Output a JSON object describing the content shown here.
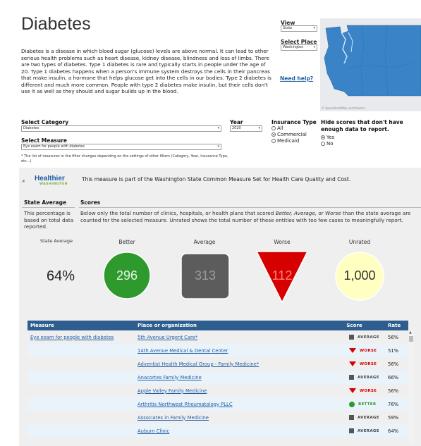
{
  "page": {
    "title": "Diabetes",
    "description": "Diabetes is a disease in which blood sugar (glucose) levels are above normal. It can lead to other serious health problems such as heart disease, kidney disease, blindness and loss of limbs. There are two types of diabetes. Type 1 diabetes is rare and typically starts in people under the age of 20. Type 1 diabetes happens when a person's immune system destroys the cells in their pancreas that make insulin, a hormone that helps glucose get into the cells in our bodies. Type 2 diabetes is different and much more common. People with type 2 diabetes make insulin, but their cells don't use it as well as they should and sugar builds up in the blood."
  },
  "view": {
    "label": "View",
    "value": "State",
    "place_label": "Select Place",
    "place_value": "Washington",
    "help": "Need help?"
  },
  "map": {
    "credit": "© OpenStreetMap contributors",
    "region_color": "#3a83c7"
  },
  "filters": {
    "category_label": "Select Category",
    "category_value": "Diabetes",
    "measure_label": "Select Measure",
    "measure_value": "Eye exam for people with diabetes",
    "year_label": "Year",
    "year_value": "2020",
    "insurance_label": "Insurance Type",
    "insurance_options": [
      "All",
      "Commercial",
      "Medicaid"
    ],
    "insurance_selected": "Commercial",
    "hide_label": "Hide scores that don't have enough data to report.",
    "hide_options": [
      "Yes",
      "No"
    ],
    "hide_selected": "Yes",
    "note": "* The list of measures in the filter changes depending on the settings of other filters (Category, Year, Insurance Type, etc...)"
  },
  "banner": {
    "logo_text": "Healthier",
    "logo_sub": "WASHINGTON",
    "text": "This measure is part of the Washington State Common Measure Set for Health Care Quality and Cost."
  },
  "state_average": {
    "heading": "State Average",
    "text": "This percentage is based on total data reported.",
    "label": "State Average",
    "value": "64%"
  },
  "scores": {
    "heading": "Scores",
    "text_pre": "Below only the total number of clinics, hospitals, or health plans that scored ",
    "text_terms": "Better, Average,",
    "text_mid": " or ",
    "text_term2": "Worse",
    "text_post": " than the state average are counted for the selected measure. Unrated shows the total number of these entities with too few cases to meaningfully report.",
    "better_label": "Better",
    "better_value": "296",
    "average_label": "Average",
    "average_value": "313",
    "worse_label": "Worse",
    "worse_value": "112",
    "unrated_label": "Unrated",
    "unrated_value": "1,000",
    "colors": {
      "better": "#2e9a2e",
      "average": "#5c5c5c",
      "worse": "#d60000",
      "unrated": "#ffffc2"
    }
  },
  "table": {
    "headers": [
      "Measure",
      "Place or organization",
      "Score",
      "Rate"
    ],
    "measure": "Eye exam for people with diabetes",
    "rows": [
      {
        "place": "5th Avenue Urgent Care*",
        "score": "AVERAGE",
        "icon": "square-icon",
        "rate": "56%"
      },
      {
        "place": "14th Avenue Medical & Dental Center",
        "score": "WORSE",
        "icon": "triangle-icon",
        "rate": "51%"
      },
      {
        "place": "Adventist Health Medical Group - Family Medicine*",
        "score": "WORSE",
        "icon": "triangle-icon",
        "rate": "56%"
      },
      {
        "place": "Anacortes Family Medicine",
        "score": "AVERAGE",
        "icon": "square-icon",
        "rate": "66%"
      },
      {
        "place": "Apple Valley Family Medicine",
        "score": "WORSE",
        "icon": "triangle-icon",
        "rate": "56%"
      },
      {
        "place": "Arthritis Northwest Rheumatology PLLC",
        "score": "BETTER",
        "icon": "circle-icon",
        "rate": "76%"
      },
      {
        "place": "Associates in Family Medicine",
        "score": "AVERAGE",
        "icon": "square-icon",
        "rate": "59%"
      },
      {
        "place": "Auburn Clinic",
        "score": "AVERAGE",
        "icon": "square-icon",
        "rate": "64%"
      }
    ]
  }
}
